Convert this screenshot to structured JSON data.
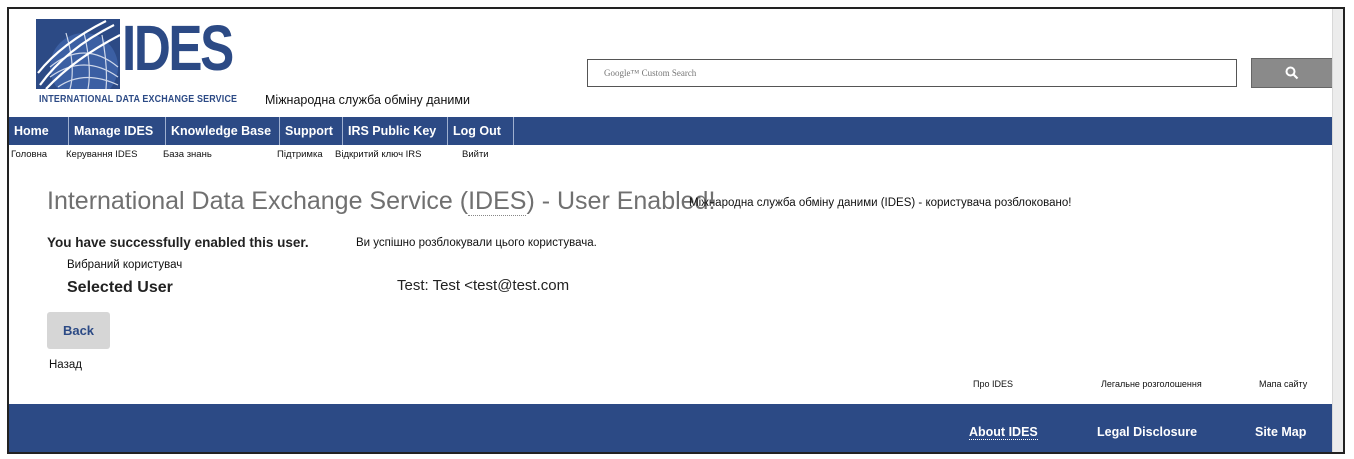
{
  "header": {
    "logo_text": "IDES",
    "logo_tagline": "INTERNATIONAL DATA EXCHANGE SERVICE",
    "logo_tagline_ua": "Міжнародна служба обміну даними",
    "search_placeholder": "Google™ Custom Search",
    "search_icon": "search-icon"
  },
  "nav": {
    "items": [
      {
        "label": "Home",
        "ua": "Головна"
      },
      {
        "label": "Manage IDES",
        "ua": "Керування IDES"
      },
      {
        "label": "Knowledge Base",
        "ua": "База знань"
      },
      {
        "label": "Support",
        "ua": "Підтримка"
      },
      {
        "label": "IRS Public Key",
        "ua": "Відкритий ключ IRS"
      },
      {
        "label": "Log Out",
        "ua": "Вийти"
      }
    ]
  },
  "main": {
    "title_prefix": "International Data Exchange Service (",
    "title_ides": "IDES",
    "title_suffix": ") - User Enabled!",
    "title_ua": "Міжнародна служба обміну даними (IDES) - користувача розблоковано!",
    "success": "You have successfully enabled this user.",
    "success_ua": "Ви успішно розблокували цього користувача.",
    "selected_label_ua": "Вибраний користувач",
    "selected_label": "Selected User",
    "selected_value": "Test: Test <test@test.com",
    "back_label": "Back",
    "back_ua": "Назад"
  },
  "footer": {
    "links": [
      {
        "label": "About IDES",
        "ua": "Про IDES"
      },
      {
        "label": "Legal Disclosure",
        "ua": "Легальне розголошення"
      },
      {
        "label": "Site Map",
        "ua": "Мапа сайту"
      }
    ]
  },
  "colors": {
    "brand_blue": "#2c4a85",
    "button_gray": "#d6d6d6"
  }
}
